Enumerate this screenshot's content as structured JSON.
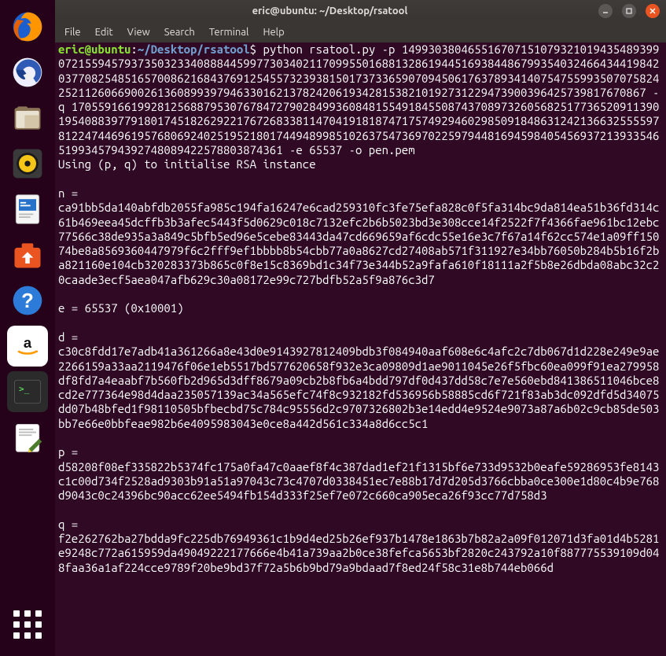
{
  "window": {
    "title": "eric@ubuntu: ~/Desktop/rsatool"
  },
  "menubar": {
    "file": "File",
    "edit": "Edit",
    "view": "View",
    "search": "Search",
    "terminal": "Terminal",
    "help": "Help"
  },
  "prompt": {
    "userhost": "eric@ubuntu",
    "sep1": ":",
    "path": "~/Desktop/rsatool",
    "sigil": "$"
  },
  "command": "python rsatool.py -p 14993038046551670715107932101943548939907215594579373503233408884459977303402117099550168813286194451693844867993540324664344198420377082548516570086216843769125455732393815017373365907094506176378934140754755993507075824252112606690026136089939794633016213782420619342815382101927312294739003964257398176708‌67 -q 17055916619928125688795307678472790284993608481554918455087437089732605682517736520911390195408839779180174518262922176726833811470419181874717574929460298509184863124213663255559781224744696195768069240251952180174494899851026375473697022597944816945984054569372139335465199345794392748089422578803874361 -e 65537 -o pen.pem",
  "output": {
    "init": "Using (p, q) to initialise RSA instance",
    "n_label": "n =",
    "n_value": "ca91bb5da140abfdb2055fa985c194fa16247e6cad259310fc3fe75efa828c0f5fa314bc9da814ea51b36fd314c61b469eea45dcffb3b3afec5443f5d0629c018c7132efc2b6b5023bd3e308cce14f2522f7f4366fae961bc12ebc77566c38de935a3a849c5bfb5ed96e5cebe83443da47cd669659af6cdc55e16e3c7f67a14f62cc574e1a09ff15074be8a8569360447979f6c2fff9ef1bbbb8b54cbb77a0a8627cd27408ab571f311927e34bb76050b284b5b16f2ba821160e104cb320283373b865c0f8e15c8369bd1c34f73e344b52a9fafa610f18111a2f5b8e26dbda08abc32c20caade3ecf5aea047afb629c30a08172e99c727bdfb52a5f9a876c3d7",
    "e_line": "e = 65537 (0x10001)",
    "d_label": "d =",
    "d_value": "c30c8fdd17e7adb41a361266a8e43d0e9143927812409bdb3f084940aaf608e6c4afc2c7db067d1d228e249e9ae2266159a33aa2119476f06e1eb5517bd577620658f932e3ca09809d1ae9011045e26f5fbc60ea099f91ea279958df8fd7a4eaabf7b560fb2d965d3dff8679a09cb2b8fb6a4bdd797df0d437dd58c7e7e560ebd841386511046bce8cd2e777364e98d4daa235057139ac34a565efc74f8c932182fd536956b58885cd6f721f83ab3dc092dfd5d34075dd07b48bfed1f98110505bfbecbd75c784c95556d2c9707326802b3e14edd4e9524e9073a87a6b02c9cb85de503bb7e66e0bbfeae982b6e4095983043e0ce8a442d561c334a8d6cc5c1",
    "p_label": "p =",
    "p_value": "d58208f08ef335822b5374fc175a0fa47c0aaef8f4c387dad1ef21f1315bf6e733d9532b0eafe59286953fe8143c1c00d734f2528ad9303b91a51a97043c73c4707d0338451ec7e88b17d7d205d3766cbba0ce300e1d80c4b9e768d9043c0c24396bc90acc62ee5494fb154d333f25ef7e072c660ca905eca26f93cc77d758d3",
    "q_label": "q =",
    "q_value": "f2e262762ba27bdda9fc225db76949361c1b9d4ed25b26ef937b1478e1863b7b82a2a09f012071d3fa01d4b5281e9248c772a615959da49049222177666e4b41a739aa2b0ce38fefca5653bf2820c243792a10f887775539109d048faa36a1af224cce9789f20be9bd37f72a5b6b9bd79a9bdaad7f8ed24f58c31e8b744eb066d"
  },
  "icons": {
    "firefox": "firefox-icon",
    "thunderbird": "thunderbird-icon",
    "files": "files-icon",
    "rhythmbox": "rhythmbox-icon",
    "writer": "writer-icon",
    "software": "software-icon",
    "help": "help-icon",
    "amazon": "amazon-icon",
    "terminal": "terminal-icon",
    "texteditor": "texteditor-icon"
  }
}
